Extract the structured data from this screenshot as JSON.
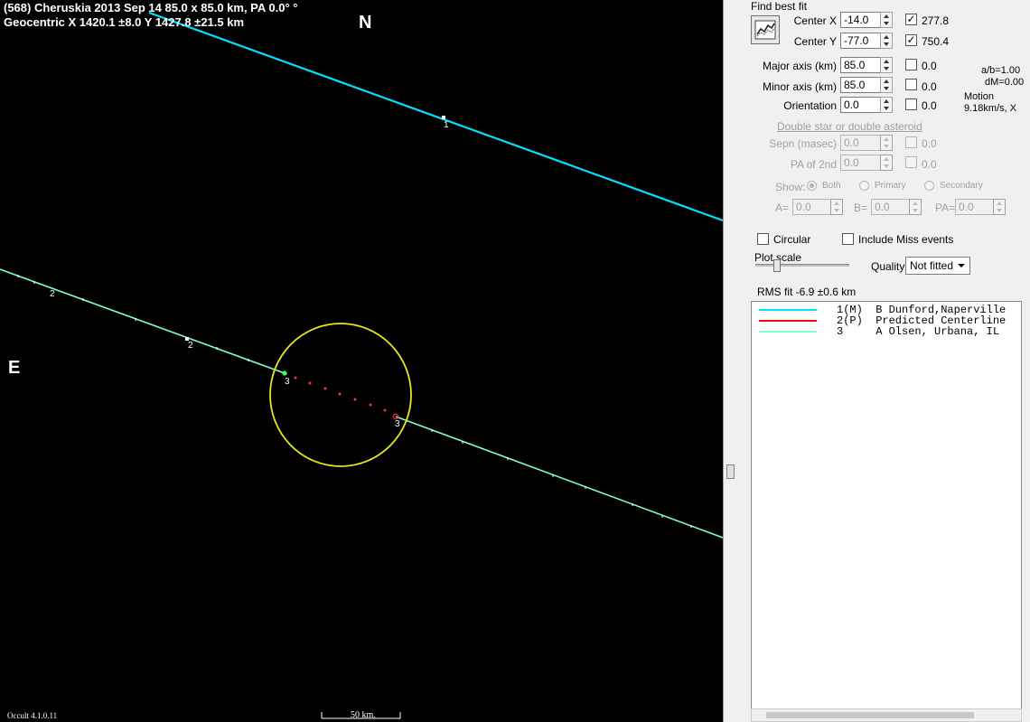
{
  "plot": {
    "title_line1": "(568) Cheruskia  2013 Sep 14   85.0 x 85.0 km,  PA 0.0° °",
    "title_line2": "Geocentric  X  1420.1 ±8.0   Y 1427.8 ±21.5 km",
    "north_label": "N",
    "east_label": "E",
    "version": "Occult 4.1.0.11",
    "scale_label": "50 km.",
    "chord_labels": [
      "1",
      "2",
      "2",
      "3",
      "3"
    ],
    "colors": {
      "chord_1": "#00e5ff",
      "chord_3": "#7fffd4",
      "ellipse": "#e8e81a",
      "predicted": "#ff3030"
    }
  },
  "panel": {
    "find_best_fit": "Find best fit",
    "center_x": {
      "label": "Center X",
      "value": "-14.0",
      "checked": true,
      "readout": "277.8"
    },
    "center_y": {
      "label": "Center Y",
      "value": "-77.0",
      "checked": true,
      "readout": "750.4"
    },
    "major_axis": {
      "label": "Major axis (km)",
      "value": "85.0",
      "checked": false,
      "readout": "0.0"
    },
    "minor_axis": {
      "label": "Minor axis (km)",
      "value": "85.0",
      "checked": false,
      "readout": "0.0"
    },
    "orientation": {
      "label": "Orientation",
      "value": "0.0",
      "checked": false,
      "readout": "0.0"
    },
    "ab_ratio": "a/b=1.00",
    "dm": "dM=0.00",
    "motion_label": "Motion",
    "motion_value": "9.18km/s, X",
    "double_star": "Double star  or  double asteroid",
    "sepn": {
      "label": "Sepn (masec)",
      "value": "0.0",
      "readout": "0.0"
    },
    "pa2nd": {
      "label": "PA of 2nd",
      "value": "0.0",
      "readout": "0.0"
    },
    "show_label": "Show:",
    "show_both": "Both",
    "show_primary": "Primary",
    "show_secondary": "Secondary",
    "a_label": "A=",
    "a_value": "0.0",
    "b_label": "B=",
    "b_value": "0.0",
    "pa_label": "PA=",
    "pa_value": "0.0",
    "circular": "Circular",
    "include_miss": "Include Miss events",
    "plot_scale": "Plot scale",
    "plot_scale_level": 0.2,
    "quality_label": "Quality",
    "quality_value": "Not fitted",
    "rms_fit": "RMS fit -6.9 ±0.6 km",
    "observers": [
      {
        "text": "1(M)  B Dunford,Naperville",
        "color": "#00e5ff"
      },
      {
        "text": "2(P)  Predicted Centerline",
        "color": "#ff0000"
      },
      {
        "text": "3     A Olsen, Urbana, IL",
        "color": "#7fffd4"
      }
    ]
  }
}
